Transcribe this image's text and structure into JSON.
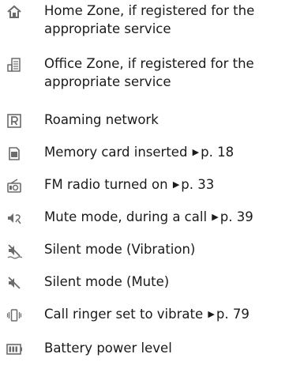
{
  "rows": [
    {
      "icon": "home-zone-icon",
      "text": [
        "Home Zone, if registered for the",
        "appropriate service"
      ]
    },
    {
      "icon": "office-zone-icon",
      "text": [
        "Office Zone, if registered for the",
        "appropriate service"
      ]
    },
    {
      "icon": "roaming-icon",
      "text": [
        "Roaming network"
      ]
    },
    {
      "icon": "memory-card-icon",
      "text": [
        "Memory card inserted"
      ],
      "page": "p. 18"
    },
    {
      "icon": "fm-radio-icon",
      "text": [
        "FM radio turned on"
      ],
      "page": "p. 33"
    },
    {
      "icon": "mute-call-icon",
      "text": [
        "Mute mode, during a call"
      ],
      "page": "p. 39"
    },
    {
      "icon": "silent-vibration-icon",
      "text": [
        "Silent mode (Vibration)"
      ]
    },
    {
      "icon": "silent-mute-icon",
      "text": [
        "Silent mode (Mute)"
      ]
    },
    {
      "icon": "vibrate-ringer-icon",
      "text": [
        "Call ringer set to vibrate"
      ],
      "page": "p. 79"
    },
    {
      "icon": "battery-icon",
      "text": [
        "Battery power level"
      ]
    }
  ],
  "colors": {
    "icon": "#6b6b6b",
    "text": "#1a1a1a"
  }
}
